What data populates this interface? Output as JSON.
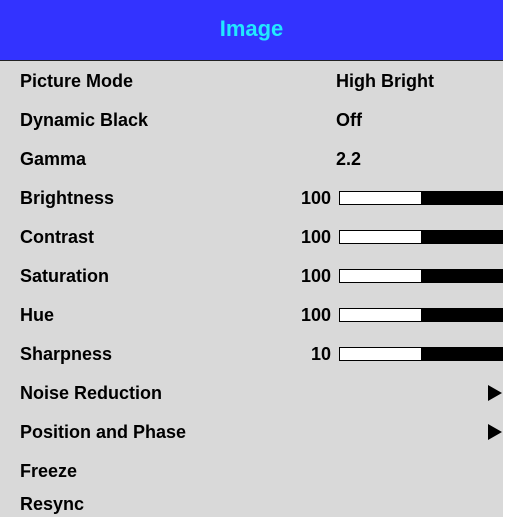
{
  "menu": {
    "title": "Image"
  },
  "rows": {
    "picture_mode": {
      "label": "Picture Mode",
      "value": "High Bright"
    },
    "dynamic_black": {
      "label": "Dynamic Black",
      "value": "Off"
    },
    "gamma": {
      "label": "Gamma",
      "value": "2.2"
    },
    "brightness": {
      "label": "Brightness",
      "value": "100",
      "level": 0.5
    },
    "contrast": {
      "label": "Contrast",
      "value": "100",
      "level": 0.5
    },
    "saturation": {
      "label": "Saturation",
      "value": "100",
      "level": 0.5
    },
    "hue": {
      "label": "Hue",
      "value": "100",
      "level": 0.5
    },
    "sharpness": {
      "label": "Sharpness",
      "value": "10",
      "level": 0.5
    },
    "noise_reduction": {
      "label": "Noise Reduction",
      "icon": "submenu-arrow-icon"
    },
    "position_and_phase": {
      "label": "Position and Phase",
      "icon": "submenu-arrow-icon"
    },
    "freeze": {
      "label": "Freeze"
    },
    "resync": {
      "label": "Resync"
    }
  },
  "colors": {
    "header_background": "#3333ff",
    "header_text": "#22e8ff",
    "menu_background": "#d9d9d9"
  }
}
